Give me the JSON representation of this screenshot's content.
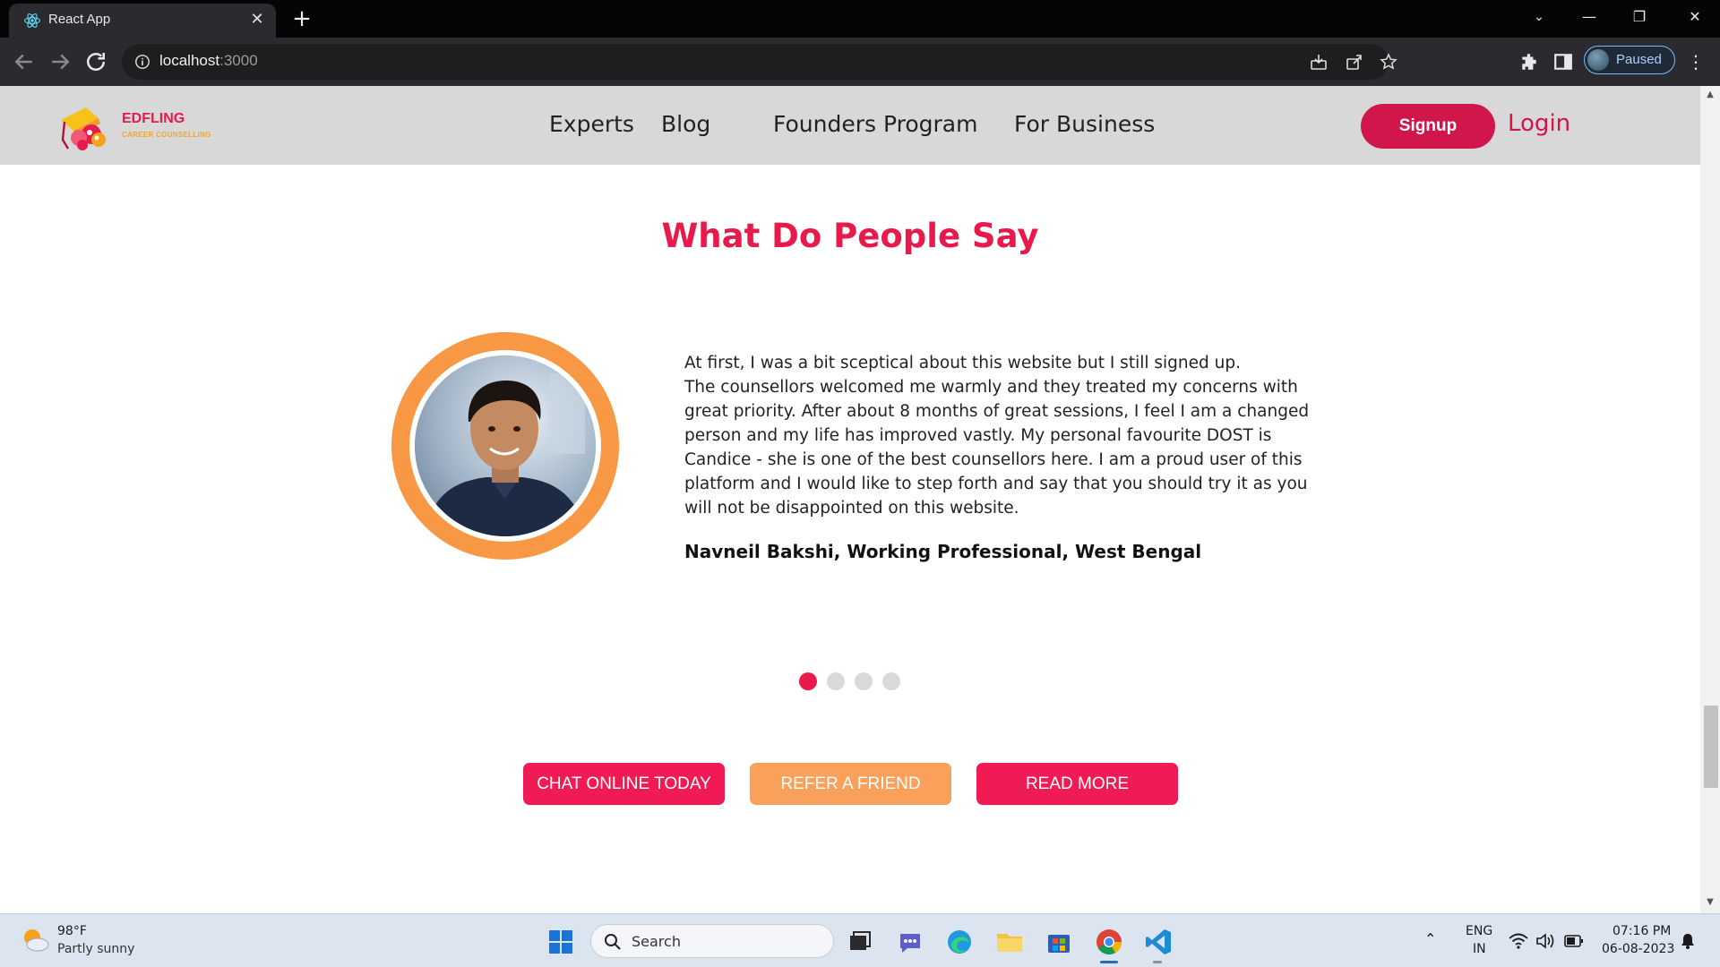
{
  "browser": {
    "tab_title": "React App",
    "url_host": "localhost",
    "url_port": ":3000",
    "profile_status": "Paused"
  },
  "site": {
    "brand_name": "EDFLING",
    "brand_sub": "CAREER COUNSELLING",
    "nav": [
      "Experts",
      "Blog",
      "Founders Program",
      "For Business"
    ],
    "signup": "Signup",
    "login": "Login"
  },
  "testimonials": {
    "title": "What Do People Say",
    "quote_line1": "At first, I was a bit sceptical about this website but I still signed up.",
    "quote_rest": "The counsellors welcomed me warmly and they treated my concerns with great priority. After about 8 months of great sessions, I feel I am a changed person and my life has improved vastly. My personal favourite DOST is Candice - she is one of the best counsellors here. I am a proud user of this platform and I would like to step forth and say that you should try it as you will not be disappointed on this website.",
    "author": "Navneil Bakshi, Working Professional, West Bengal",
    "slide_count": 4,
    "active_slide": 1
  },
  "cta": {
    "chat": "CHAT ONLINE TODAY",
    "refer": "REFER A FRIEND",
    "read": "READ MORE"
  },
  "taskbar": {
    "weather_temp": "98°F",
    "weather_desc": "Partly sunny",
    "search_placeholder": "Search",
    "lang_top": "ENG",
    "lang_bottom": "IN",
    "time": "07:16 PM",
    "date": "06-08-2023"
  },
  "colors": {
    "brand_pink": "#e8194b",
    "brand_orange": "#f89744",
    "header_bg": "#d8d8d8"
  }
}
